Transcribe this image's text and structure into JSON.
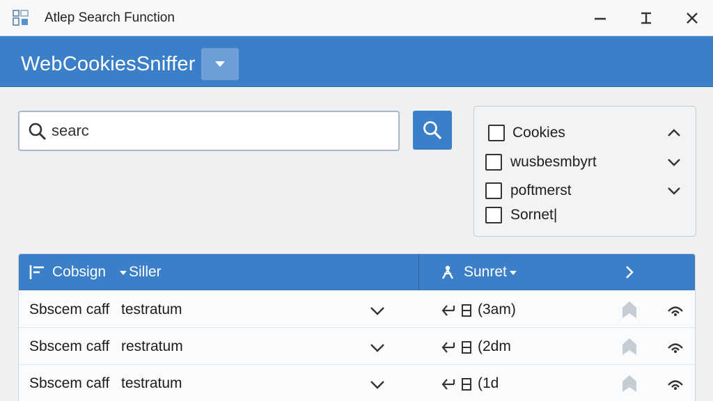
{
  "window": {
    "title": "Atlep Search Function"
  },
  "header": {
    "app_name": "WebCookiesSniffer"
  },
  "search": {
    "value": "searc",
    "placeholder": ""
  },
  "filters": [
    {
      "label": "Cookies",
      "checked": false,
      "chevron": "up"
    },
    {
      "label": "wusbesmbyrt",
      "checked": false,
      "chevron": "down"
    },
    {
      "label": "poftmerst",
      "checked": false,
      "chevron": "down"
    },
    {
      "label": "Sornet|",
      "checked": false,
      "chevron": "none"
    }
  ],
  "table": {
    "columns": [
      {
        "label": "Cobsign"
      },
      {
        "label": "Siller"
      },
      {
        "label": "Sunret"
      }
    ],
    "rows": [
      {
        "col1": "Sbscem caff",
        "col2": "testratum",
        "col3": "(3am)"
      },
      {
        "col1": "Sbscem caff",
        "col2": "restratum",
        "col3": "(2dm"
      },
      {
        "col1": "Sbscem caff",
        "col2": "testratum",
        "col3": "(1d"
      }
    ]
  },
  "colors": {
    "accent": "#3b7fc8",
    "titlebar": "#f7f8f9",
    "background": "#eef0f2"
  },
  "icons": {
    "app": "window-grid-icon",
    "minimize": "minimize-icon",
    "maximize": "maximize-icon",
    "close": "close-icon",
    "search": "search-icon",
    "row_action": "return-arrow-icon",
    "row_flag": "bookmark-icon",
    "row_signal": "signal-icon"
  }
}
